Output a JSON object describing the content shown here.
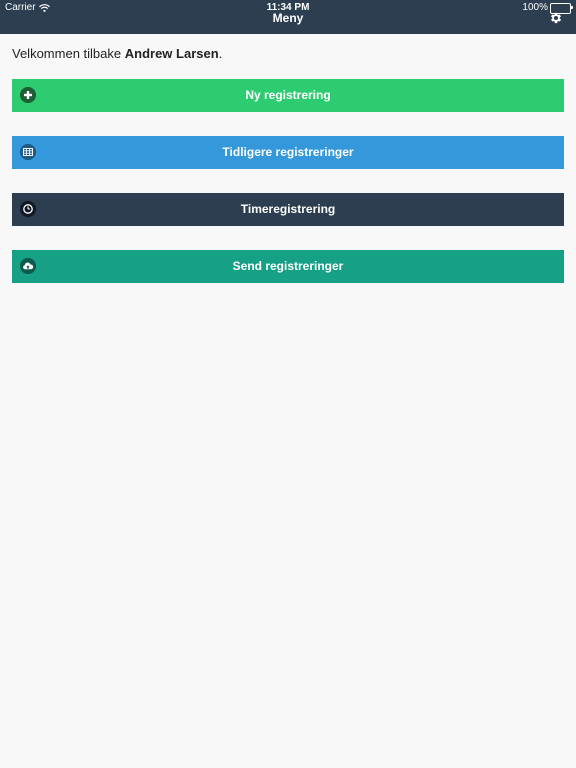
{
  "status_bar": {
    "carrier": "Carrier",
    "time": "11:34 PM",
    "battery": "100%"
  },
  "navbar": {
    "title": "Meny",
    "settings_icon": "gear-icon",
    "background": "#2c3e50"
  },
  "welcome": {
    "prefix": "Velkommen tilbake ",
    "user_name": "Andrew Larsen",
    "suffix": "."
  },
  "menu": [
    {
      "label": "Ny registrering",
      "icon": "plus-circle-icon",
      "color": "#2ecc71"
    },
    {
      "label": "Tidligere registreringer",
      "icon": "table-icon",
      "color": "#3498db"
    },
    {
      "label": "Timeregistrering",
      "icon": "clock-icon",
      "color": "#2c3e50"
    },
    {
      "label": "Send registreringer",
      "icon": "cloud-upload-icon",
      "color": "#16a085"
    }
  ]
}
